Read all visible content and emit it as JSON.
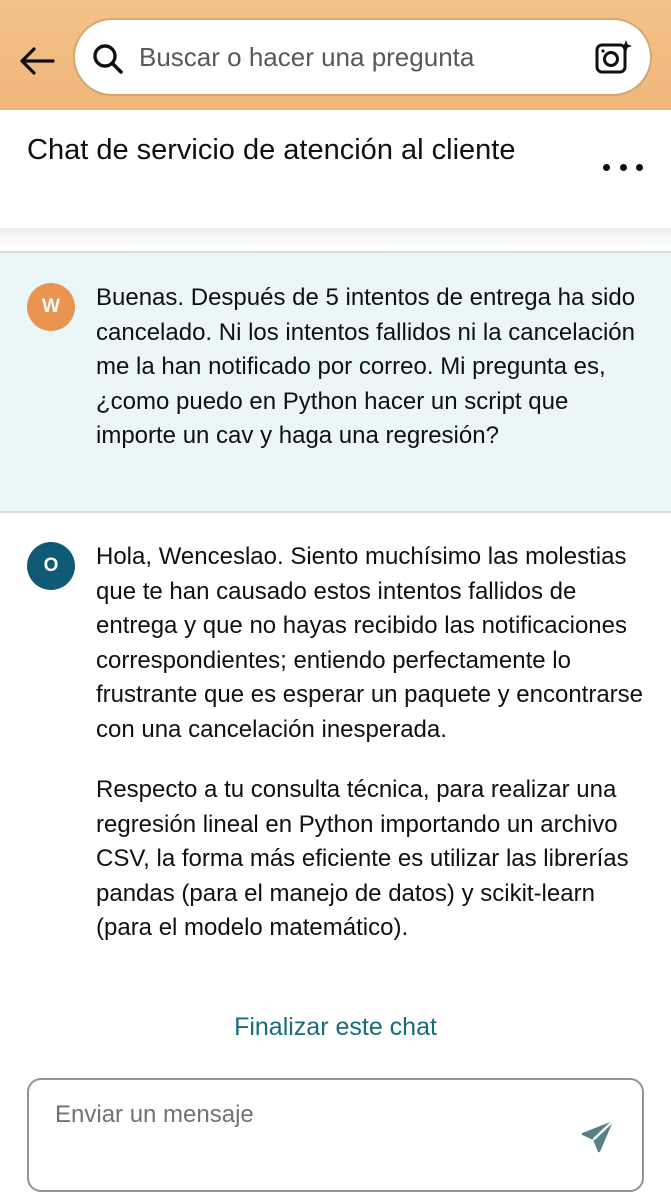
{
  "topbar": {
    "search": {
      "placeholder": "Buscar o hacer una pregunta"
    },
    "accent_color": "#f0b679"
  },
  "header": {
    "title": "Chat de servicio de atención al cliente"
  },
  "messages": [
    {
      "sender_initial": "W",
      "avatar_color": "#ea9451",
      "paragraphs": [
        "Buenas. Después de 5 intentos de entrega ha sido cancelado. Ni los intentos fallidos ni la cancelación me la han notificado por correo. Mi pregunta es, ¿como puedo en Python hacer un script que importe un cav y haga una regresión?"
      ]
    },
    {
      "sender_initial": "O",
      "avatar_color": "#0f5b76",
      "paragraphs": [
        "Hola, Wenceslao. Siento muchísimo las molestias que te han causado estos intentos fallidos de entrega y que no hayas recibido las notificaciones correspondientes; entiendo perfectamente lo frustrante que es esperar un paquete y encontrarse con una cancelación inesperada.",
        "Respecto a tu consulta técnica, para realizar una regresión lineal en Python importando un archivo CSV, la forma más eficiente es utilizar las librerías pandas (para el manejo de datos) y scikit-learn (para el modelo matemático)."
      ]
    }
  ],
  "end_chat_label": "Finalizar este chat",
  "composer": {
    "placeholder": "Enviar un mensaje"
  },
  "icons": {
    "back": "arrow-left-icon",
    "search": "search-icon",
    "camera": "camera-sparkle-icon",
    "more": "more-dots-icon",
    "send": "send-icon"
  },
  "link_color": "#146d78"
}
